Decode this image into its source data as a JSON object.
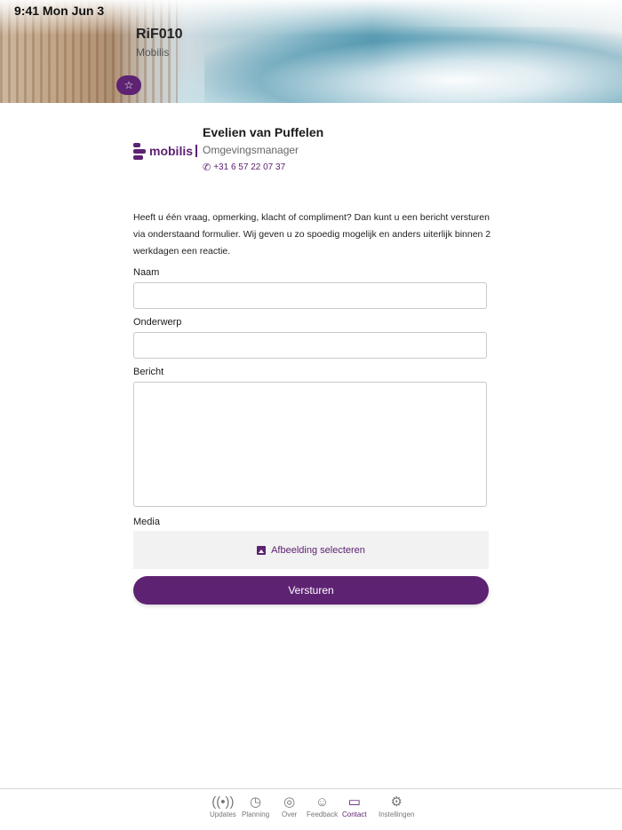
{
  "status_bar": {
    "time": "9:41  Mon Jun 3"
  },
  "header": {
    "title": "RiF010",
    "subtitle": "Mobilis",
    "favorite_icon": "star-icon"
  },
  "contact_card": {
    "logo_text": "mobilis",
    "name": "Evelien van Puffelen",
    "role": "Omgevingsmanager",
    "phone": "+31 6 57 22 07 37",
    "phone_icon": "phone-icon"
  },
  "intro_text": "Heeft u één vraag, opmerking, klacht of compliment? Dan kunt u een bericht versturen via onderstaand formulier. Wij geven u zo spoedig mogelijk en anders uiterlijk binnen 2 werkdagen een reactie.",
  "form": {
    "name_label": "Naam",
    "name_value": "",
    "subject_label": "Onderwerp",
    "subject_value": "",
    "message_label": "Bericht",
    "message_value": "",
    "media_label": "Media",
    "media_button": "Afbeelding selecteren",
    "submit": "Versturen"
  },
  "tabbar": {
    "items": [
      {
        "label": "Updates",
        "icon": "broadcast-icon"
      },
      {
        "label": "Planning",
        "icon": "clock-icon"
      },
      {
        "label": "Over",
        "icon": "fingerprint-icon"
      },
      {
        "label": "Feedback",
        "icon": "smiley-icon"
      },
      {
        "label": "Contact",
        "icon": "chat-icon"
      },
      {
        "label": "Instellingen",
        "icon": "gear-icon"
      }
    ],
    "active": "Contact"
  },
  "colors": {
    "accent": "#5e2272"
  }
}
